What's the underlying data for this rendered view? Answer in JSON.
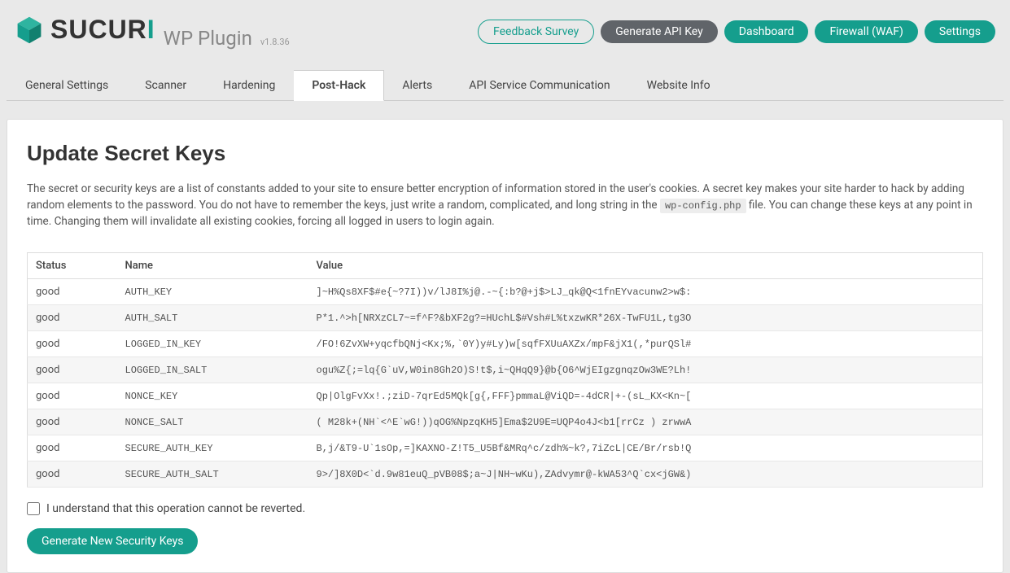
{
  "brand": {
    "logo_text_1": "SUCUR",
    "logo_text_2": "I",
    "plugin_title": "WP Plugin",
    "version": "v1.8.36"
  },
  "header_buttons": {
    "feedback": "Feedback Survey",
    "generate_api": "Generate API Key",
    "dashboard": "Dashboard",
    "firewall": "Firewall (WAF)",
    "settings": "Settings"
  },
  "tabs": [
    {
      "id": "general",
      "label": "General Settings",
      "active": false
    },
    {
      "id": "scanner",
      "label": "Scanner",
      "active": false
    },
    {
      "id": "hardening",
      "label": "Hardening",
      "active": false
    },
    {
      "id": "post-hack",
      "label": "Post-Hack",
      "active": true
    },
    {
      "id": "alerts",
      "label": "Alerts",
      "active": false
    },
    {
      "id": "api",
      "label": "API Service Communication",
      "active": false
    },
    {
      "id": "website-info",
      "label": "Website Info",
      "active": false
    }
  ],
  "panel": {
    "title": "Update Secret Keys",
    "desc_1": "The secret or security keys are a list of constants added to your site to ensure better encryption of information stored in the user's cookies. A secret key makes your site harder to hack by adding random elements to the password. You do not have to remember the keys, just write a random, complicated, and long string in the ",
    "desc_code": "wp-config.php",
    "desc_2": " file. You can change these keys at any point in time. Changing them will invalidate all existing cookies, forcing all logged in users to login again.",
    "columns": {
      "status": "Status",
      "name": "Name",
      "value": "Value"
    },
    "rows": [
      {
        "status": "good",
        "name": "AUTH_KEY",
        "value": "]~H%Qs8XF$#e{~?7I))v/lJ8I%j@.-~{:b?@+j$>LJ_qk@Q<1fnEYvacunw2>w$:"
      },
      {
        "status": "good",
        "name": "AUTH_SALT",
        "value": "P*1.^>h[NRXzCL7~=f^F?&bXF2g?=HUchL$#Vsh#L%txzwKR*26X-TwFU1L,tg3O"
      },
      {
        "status": "good",
        "name": "LOGGED_IN_KEY",
        "value": "/FO!6ZvXW+yqcfbQNj<Kx;%,`0Y)y#Ly)w[sqfFXUuAXZx/mpF&jX1(,*purQSl#"
      },
      {
        "status": "good",
        "name": "LOGGED_IN_SALT",
        "value": "ogu%Z{;=lq{G`uV,W0in8Gh2O)S!t$,i~QHqQ9}@b{O6^WjEIgzgnqzOw3WE?Lh!"
      },
      {
        "status": "good",
        "name": "NONCE_KEY",
        "value": "Qp|OlgFvXx!.;ziD-7qrEd5MQk[g{,FFF}pmmaL@ViQD=-4dCR|+-(sL_KX<Kn~["
      },
      {
        "status": "good",
        "name": "NONCE_SALT",
        "value": "( M28k+(NH`<^E`wG!))qOG%NpzqKH5]Ema$2U9E=UQP4o4J<b1[rrCz ) zrwwA"
      },
      {
        "status": "good",
        "name": "SECURE_AUTH_KEY",
        "value": "B,j/&T9-U`1sOp,=]KAXNO-Z!T5_U5Bf&MRq^c/zdh%~k?,7iZcL|CE/Br/rsb!Q"
      },
      {
        "status": "good",
        "name": "SECURE_AUTH_SALT",
        "value": "9>/]8X0D<`d.9w81euQ_pVB08$;a~J|NH~wKu),ZAdvymr@-kWA53^Q`cx<jGW&)"
      }
    ],
    "confirm_label": "I understand that this operation cannot be reverted.",
    "generate_label": "Generate New Security Keys"
  }
}
